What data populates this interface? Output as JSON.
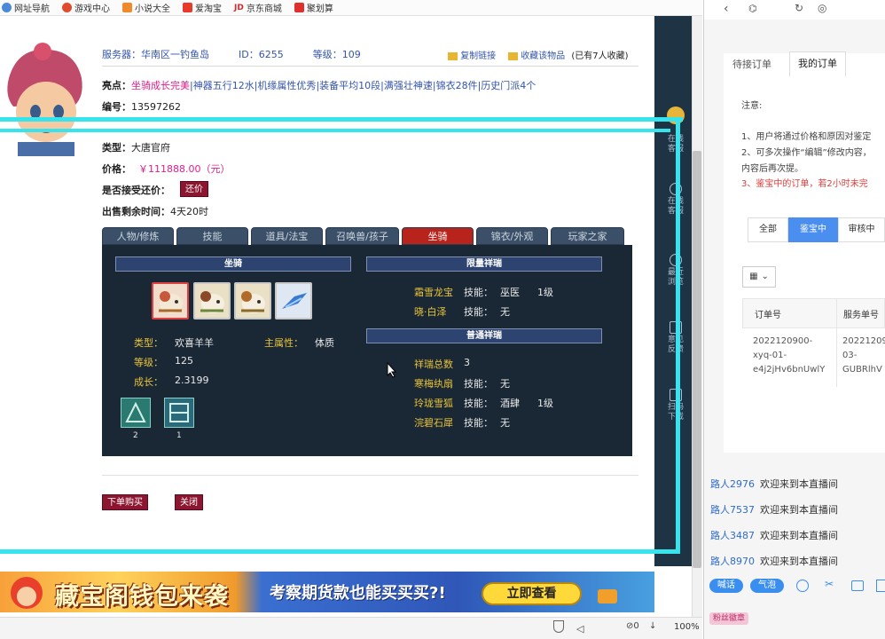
{
  "bookmarks": [
    {
      "label": "网址导航",
      "color": "#4a88d8"
    },
    {
      "label": "游戏中心",
      "color": "#e04b2d"
    },
    {
      "label": "小说大全",
      "color": "#f08a2a"
    },
    {
      "label": "爱淘宝",
      "color": "#e83a2a"
    },
    {
      "label": "京东商城",
      "color": "#d8262b",
      "prefix": "JD"
    },
    {
      "label": "聚划算",
      "color": "#e0302e"
    }
  ],
  "item": {
    "server_label": "服务器：",
    "server": "华南区一钓鱼岛",
    "id_label": "ID：",
    "id": "6255",
    "level_label": "等级：",
    "level": "109",
    "copy_link": "复制链接",
    "collect": "收藏该物品",
    "collect_count": "(已有7人收藏)",
    "highlights_label": "亮点：",
    "highlight_first": "坐骑成长完美",
    "highlights": [
      "神器五行12水",
      "机缘属性优秀",
      "装备平均10段",
      "满强壮神速",
      "锦衣28件",
      "历史门派4个"
    ],
    "number_label": "编号：",
    "number": "13597262",
    "type_label": "类型：",
    "type": "大唐官府",
    "price_label": "价格：",
    "price": "￥111888.00（元）",
    "bargain_label": "是否接受还价：",
    "bargain_button": "还价",
    "time_label": "出售剩余时间：",
    "time": "4天20时"
  },
  "tabs": [
    "人物/修炼",
    "技能",
    "道具/法宝",
    "召唤兽/孩子",
    "坐骑",
    "锦衣/外观",
    "玩家之家"
  ],
  "mount": {
    "header": "坐骑",
    "type_label": "类型：",
    "type": "欢喜羊羊",
    "main_attr_label": "主属性：",
    "main_attr": "体质",
    "level_label": "等级：",
    "level": "125",
    "growth_label": "成长：",
    "growth": "2.3199",
    "badges": [
      "2",
      "1"
    ]
  },
  "limited": {
    "header": "限量祥瑞",
    "items": [
      {
        "name": "霜雪龙宝",
        "skill_label": "技能：",
        "skill": "巫医",
        "lv": "1级"
      },
      {
        "name": "晓·白泽",
        "skill_label": "技能：",
        "skill": "无",
        "lv": ""
      }
    ]
  },
  "normal": {
    "header": "普通祥瑞",
    "count_label": "祥瑞总数",
    "count": "3",
    "items": [
      {
        "name": "寒梅纨扇",
        "skill_label": "技能：",
        "skill": "无",
        "lv": ""
      },
      {
        "name": "玲珑雪狐",
        "skill_label": "技能：",
        "skill": "酒肆",
        "lv": "1级"
      },
      {
        "name": "浣碧石犀",
        "skill_label": "技能：",
        "skill": "无",
        "lv": ""
      }
    ]
  },
  "actions": {
    "buy": "下单购买",
    "close": "关闭"
  },
  "sidebar": [
    "在线客服",
    "在线客服",
    "最近浏览",
    "意见反馈",
    "扫码下载"
  ],
  "banner": {
    "text": "藏宝阁钱包来袭",
    "sub": "考察期货款也能买买买?!",
    "cta": "立即查看"
  },
  "status": {
    "zoom": "100%",
    "mute": "0"
  },
  "right": {
    "tab_pending": "待接订单",
    "tab_mine": "我的订单",
    "notice_title": "注意:",
    "notice": [
      "1、用户将通过价格和原因对鉴定",
      "2、可多次操作“编辑”修改内容，",
      "内容后再次提。",
      "3、鉴宝中的订单，若2小时未完"
    ],
    "filters": [
      "全部",
      "鉴宝中",
      "审核中"
    ],
    "col_order": "订单号",
    "col_service": "服务单号",
    "row": {
      "order": [
        "2022120900-",
        "xyq-01-",
        "e4j2jHv6bnUwlY"
      ],
      "service": [
        "20221209",
        "03-",
        "GUBRlhV"
      ]
    },
    "chat": [
      {
        "name": "路人2976",
        "text": "欢迎来到本直播间"
      },
      {
        "name": "路人7537",
        "text": "欢迎来到本直播间"
      },
      {
        "name": "路人3487",
        "text": "欢迎来到本直播间"
      },
      {
        "name": "路人8970",
        "text": "欢迎来到本直播间"
      }
    ],
    "chat_tools": [
      "喊话",
      "气泡"
    ],
    "fan_badge": "粉丝徽章"
  }
}
